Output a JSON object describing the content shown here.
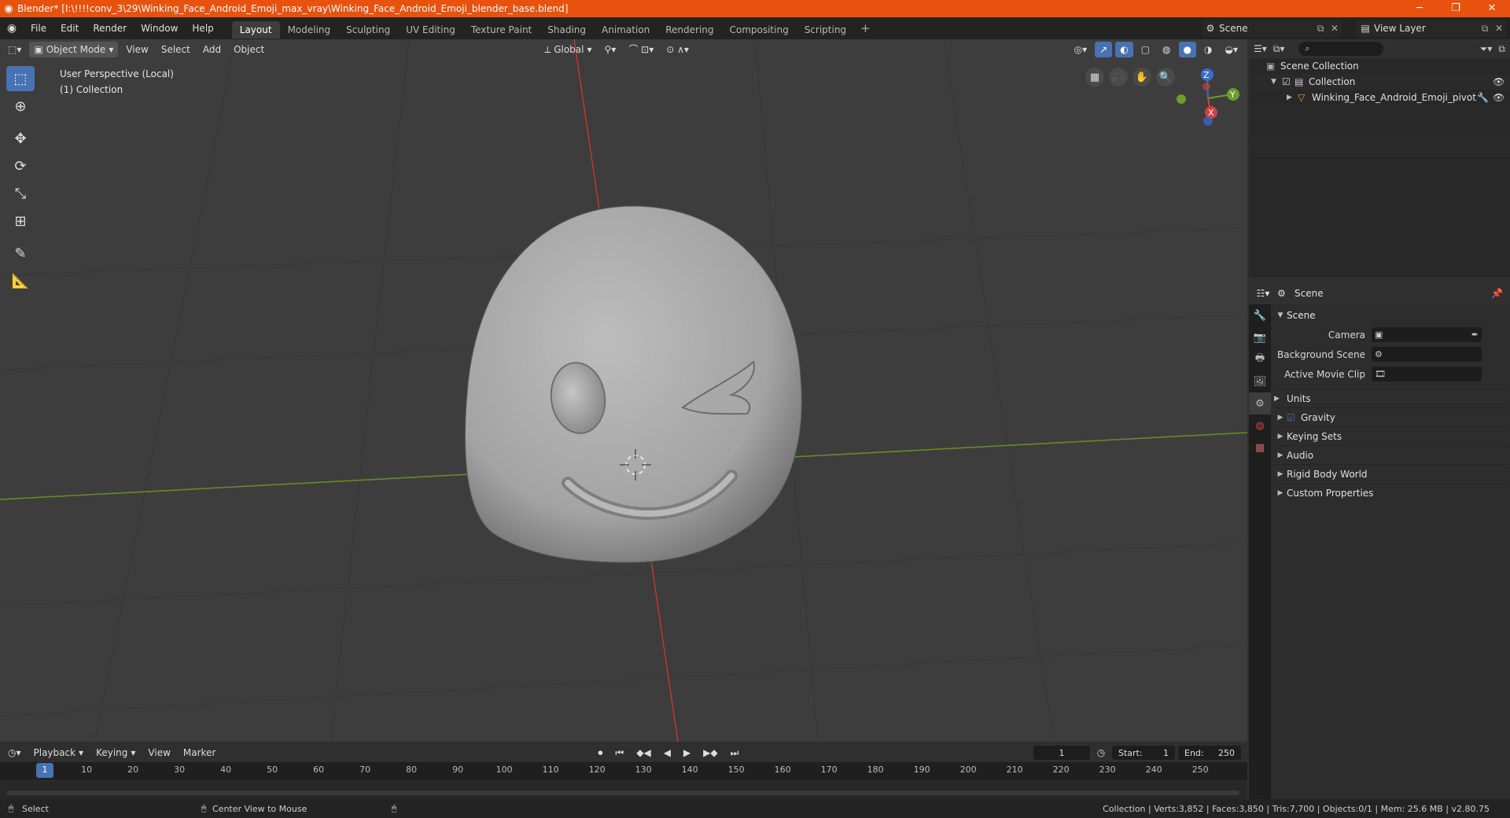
{
  "window": {
    "title": "Blender* [I:\\!!!!conv_3\\29\\Winking_Face_Android_Emoji_max_vray\\Winking_Face_Android_Emoji_blender_base.blend]",
    "minimize": "─",
    "maximize": "❐",
    "close": "✕"
  },
  "menu": [
    "File",
    "Edit",
    "Render",
    "Window",
    "Help"
  ],
  "workspaces": [
    "Layout",
    "Modeling",
    "Sculpting",
    "UV Editing",
    "Texture Paint",
    "Shading",
    "Animation",
    "Rendering",
    "Compositing",
    "Scripting"
  ],
  "scene_selector": "Scene",
  "view_layer": "View Layer",
  "viewport": {
    "mode": "Object Mode",
    "menus": [
      "View",
      "Select",
      "Add",
      "Object"
    ],
    "orientation": "Global",
    "perspective_label": "User Perspective (Local)",
    "collection_label": "(1) Collection",
    "axis_x": "X",
    "axis_y": "Y",
    "axis_z": "Z"
  },
  "outliner": {
    "search_placeholder": "",
    "root": "Scene Collection",
    "collection": "Collection",
    "object": "Winking_Face_Android_Emoji_pivot"
  },
  "properties": {
    "context": "Scene",
    "panel": "Scene",
    "camera_label": "Camera",
    "background_scene_label": "Background Scene",
    "active_movie_clip_label": "Active Movie Clip",
    "subpanels": [
      "Units",
      "Gravity",
      "Keying Sets",
      "Audio",
      "Rigid Body World",
      "Custom Properties"
    ]
  },
  "timeline": {
    "menus": [
      "Playback",
      "Keying",
      "View",
      "Marker"
    ],
    "current_frame": "1",
    "start_label": "Start:",
    "start": "1",
    "end_label": "End:",
    "end": "250",
    "ticks": [
      "1",
      "10",
      "20",
      "30",
      "40",
      "50",
      "60",
      "70",
      "80",
      "90",
      "100",
      "110",
      "120",
      "130",
      "140",
      "150",
      "160",
      "170",
      "180",
      "190",
      "200",
      "210",
      "220",
      "230",
      "240",
      "250"
    ]
  },
  "status": {
    "select": "Select",
    "center_view": "Center View to Mouse",
    "stats": "Collection | Verts:3,852 | Faces:3,850 | Tris:7,700 | Objects:0/1 | Mem: 25.6 MB | v2.80.75"
  },
  "colors": {
    "accent": "#4772b3",
    "titlebar": "#e8520e",
    "x_axis": "#c0392b",
    "y_axis": "#6b8e23"
  }
}
